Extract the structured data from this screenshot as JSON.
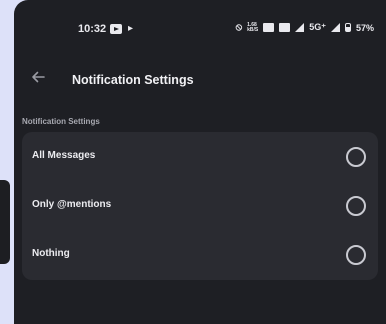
{
  "status_bar": {
    "time": "10:32",
    "speed_top": "1.68",
    "speed_bottom": "kB/S",
    "network": "5G⁺",
    "battery": "57%"
  },
  "header": {
    "title": "Notification Settings"
  },
  "section": {
    "label": "Notification Settings"
  },
  "options": [
    {
      "label": "All Messages",
      "selected": false
    },
    {
      "label": "Only @mentions",
      "selected": false
    },
    {
      "label": "Nothing",
      "selected": false
    }
  ],
  "colors": {
    "background": "#1e1f24",
    "card": "#2a2b31",
    "frame": "#dde1f9"
  }
}
